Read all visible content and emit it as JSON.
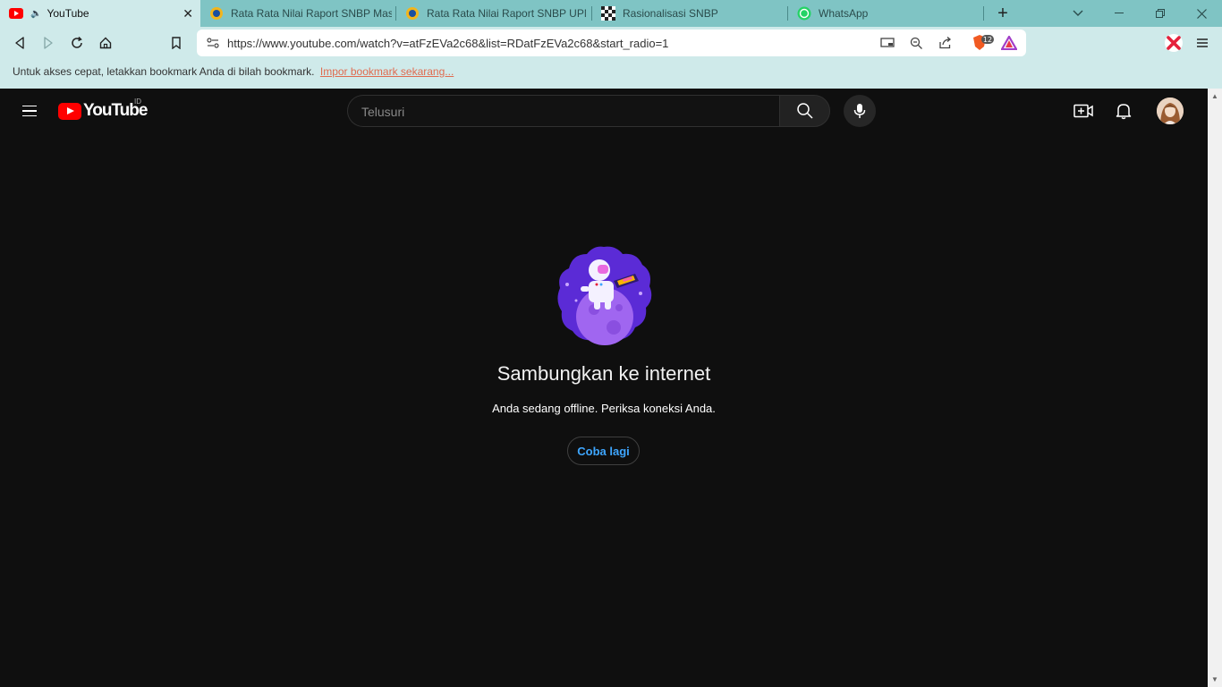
{
  "browser": {
    "tabs": [
      {
        "title": "YouTube",
        "favicon": "youtube-icon",
        "active": true,
        "audio": true
      },
      {
        "title": "Rata Rata Nilai Raport SNBP Masu",
        "favicon": "university-logo-icon"
      },
      {
        "title": "Rata Rata Nilai Raport SNBP UPN",
        "favicon": "university-logo-icon"
      },
      {
        "title": "Rasionalisasi SNBP",
        "favicon": "pattern-favicon-icon"
      },
      {
        "title": "WhatsApp",
        "favicon": "whatsapp-icon"
      }
    ],
    "new_tab_label": "+",
    "url": "https://www.youtube.com/watch?v=atFzEVa2c68&list=RDatFzEVa2c68&start_radio=1",
    "brave_shield_count": "12",
    "bookmark_bar": {
      "text": "Untuk akses cepat, letakkan bookmark Anda di bilah bookmark.",
      "link": "Impor bookmark sekarang..."
    }
  },
  "youtube": {
    "logo_text": "YouTube",
    "country_code": "ID",
    "search_placeholder": "Telusuri",
    "offline_title": "Sambungkan ke internet",
    "offline_message": "Anda sedang offline. Periksa koneksi Anda.",
    "retry_label": "Coba lagi"
  },
  "colors": {
    "chrome_bg": "#cfeaea",
    "tabstrip_bg": "#7fc4c4",
    "page_bg": "#0f0f0f",
    "link_blue": "#3ea6ff",
    "yt_red": "#ff0000"
  }
}
